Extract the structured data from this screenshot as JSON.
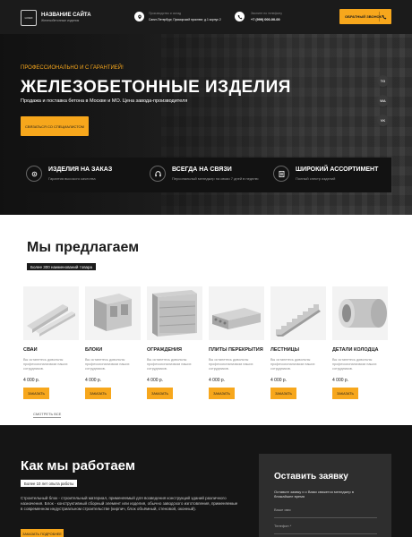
{
  "header": {
    "logo_text": "LOGO",
    "site_name": "НАЗВАНИЕ САЙТА",
    "site_sub": "Железобетонные изделия",
    "address_label": "Производство и склад",
    "address_value": "Санкт-Петербург, Приморский проспект, д.1 корпус 2",
    "phone_label": "Звоните по телефону",
    "phone_value": "+7 (999) 000-00-00",
    "callback_label": "ОБРАТНЫЙ ЗВОНОК"
  },
  "hero": {
    "kicker": "ПРОФЕССИОНАЛЬНО И С ГАРАНТИЕЙ!",
    "title": "ЖЕЛЕЗОБЕТОННЫЕ ИЗДЕЛИЯ",
    "description": "Продажа и поставка бетона в Москве и МО. Цена завода-производителя",
    "button_label": "СВЯЗАТЬСЯ СО СПЕЦИАЛИСТОМ",
    "socials": [
      "TG",
      "WA",
      "VK"
    ],
    "features": [
      {
        "title": "ИЗДЕЛИЯ НА ЗАКАЗ",
        "desc": "Гарантия высокого качества",
        "icon": "gear-icon"
      },
      {
        "title": "ВСЕГДА НА СВЯЗИ",
        "desc": "Персональный менеджер на связи 7 дней в неделю",
        "icon": "support-icon"
      },
      {
        "title": "ШИРОКИЙ АССОРТИМЕНТ",
        "desc": "Полный спектр изделий",
        "icon": "catalog-icon"
      }
    ]
  },
  "offer": {
    "title": "Мы предлагаем",
    "badge": "Более 300 наименований товара",
    "show_all": "СМОТРЕТЬ ВСЕ",
    "products": [
      {
        "name": "СВАИ",
        "desc": "Вы останетесь довольны профессионализмом наших сотрудников.",
        "price": "4 000 р.",
        "order": "ЗАКАЗАТЬ"
      },
      {
        "name": "БЛОКИ",
        "desc": "Вы останетесь довольны профессионализмом наших сотрудников.",
        "price": "4 000 р.",
        "order": "ЗАКАЗАТЬ"
      },
      {
        "name": "ОГРАЖДЕНИЯ",
        "desc": "Вы останетесь довольны профессионализмом наших сотрудников.",
        "price": "4 000 р.",
        "order": "ЗАКАЗАТЬ"
      },
      {
        "name": "ПЛИТЫ ПЕРЕКРЫТИЯ",
        "desc": "Вы останетесь довольны профессионализмом наших сотрудников.",
        "price": "4 000 р.",
        "order": "ЗАКАЗАТЬ"
      },
      {
        "name": "ЛЕСТНИЦЫ",
        "desc": "Вы останетесь довольны профессионализмом наших сотрудников.",
        "price": "4 000 р.",
        "order": "ЗАКАЗАТЬ"
      },
      {
        "name": "ДЕТАЛИ КОЛОДЦА",
        "desc": "Вы останетесь довольны профессионализмом наших сотрудников.",
        "price": "4 000 р.",
        "order": "ЗАКАЗАТЬ"
      }
    ]
  },
  "work": {
    "title": "Как мы работаем",
    "badge": "Более 10 лет опыта работы",
    "text": "Строительный блок - строительный материал, применяемый для возведения конструкций зданий различного назначения. Блок - конструктивный сборный элемент или изделия, обычно заводского изготовления, применяемые в современном индустриальном строительстве (кирпич, блок объёмный, стеновой, оконный).",
    "button_label": "ЗАКАЗАТЬ ПОДРОБНЕЕ"
  },
  "form": {
    "title": "Оставить заявку",
    "desc": "Оставьте заявку и с Вами свяжется менеджер в ближайшее время",
    "name_placeholder": "Ваше имя",
    "phone_placeholder": "Телефон *"
  },
  "colors": {
    "accent": "#f7a71c",
    "dark": "#1b1b1b"
  }
}
